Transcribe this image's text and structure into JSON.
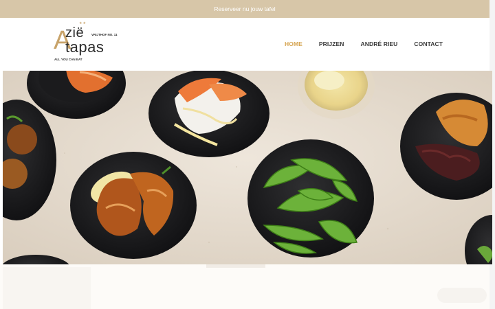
{
  "topbar": {
    "reserve_link": "Reserveer nu jouw tafel"
  },
  "logo": {
    "letter": "A",
    "line1": "zië",
    "line2": "tapas",
    "address": "VRIJTHOF NO. 11",
    "tagline": "ALL YOU CAN EAT",
    "stars": "★★"
  },
  "nav": {
    "items": [
      {
        "label": "HOME",
        "active": true
      },
      {
        "label": "PRIJZEN",
        "active": false
      },
      {
        "label": "ANDRÉ RIEU",
        "active": false
      },
      {
        "label": "CONTACT",
        "active": false
      }
    ]
  },
  "colors": {
    "topbar": "#d7c6a8",
    "accent": "#d6a552",
    "text": "#3a3a3a"
  },
  "hero": {
    "image": "tapas-dishes-photo"
  }
}
